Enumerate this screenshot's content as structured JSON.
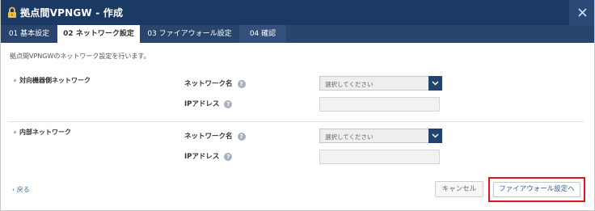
{
  "window": {
    "title": "拠点間VPNGW - 作成",
    "close_label": "×"
  },
  "tabs": [
    {
      "label": "01 基本設定"
    },
    {
      "label": "02 ネットワーク設定"
    },
    {
      "label": "03 ファイアウォール設定"
    },
    {
      "label": "04 確認"
    }
  ],
  "description": "拠点間VPNGWのネットワーク設定を行います。",
  "sections": [
    {
      "label": "対向機器側ネットワーク",
      "network_label": "ネットワーク名",
      "network_select_value": "選択してください",
      "ip_label": "IPアドレス",
      "ip_value": ""
    },
    {
      "label": "内部ネットワーク",
      "network_label": "ネットワーク名",
      "network_select_value": "選択してください",
      "ip_label": "IPアドレス",
      "ip_value": ""
    }
  ],
  "help_glyph": "?",
  "footer": {
    "back_label": "‹ 戻る",
    "cancel_label": "キャンセル",
    "next_label": "ファイアウォール設定へ"
  },
  "colors": {
    "titlebar": "#1b3a63",
    "tabs_bg": "#29456c",
    "highlight_border": "#e0161c",
    "link": "#3c6fb0"
  },
  "icons": [
    "lock-icon",
    "close-icon",
    "help-icon",
    "chevron-down-icon",
    "chevron-left-icon"
  ]
}
